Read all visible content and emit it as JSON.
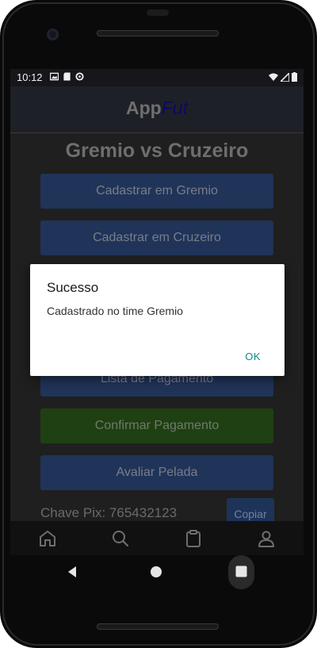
{
  "status_bar": {
    "time": "10:12"
  },
  "app_bar": {
    "brand_part1": "App",
    "brand_part2": "Fut"
  },
  "page": {
    "title": "Gremio vs Cruzeiro"
  },
  "buttons": {
    "register_team1": "Cadastrar em Gremio",
    "register_team2": "Cadastrar em Cruzeiro",
    "payment_list": "Lista de Pagamento",
    "confirm_payment": "Confirmar Pagamento",
    "rate_match": "Avaliar Pelada",
    "copy": "Copiar"
  },
  "pix": {
    "label": "Chave Pix: 765432123"
  },
  "dialog": {
    "title": "Sucesso",
    "message": "Cadastrado no time Gremio",
    "ok": "OK"
  },
  "tabs": [
    {
      "icon": "home-icon"
    },
    {
      "icon": "search-icon"
    },
    {
      "icon": "clipboard-icon"
    },
    {
      "icon": "person-icon"
    }
  ],
  "colors": {
    "accent_blue": "#203459",
    "accent_green": "#1f4013",
    "dialog_action": "#118a8a",
    "brand_accent": "#0a0a66"
  }
}
